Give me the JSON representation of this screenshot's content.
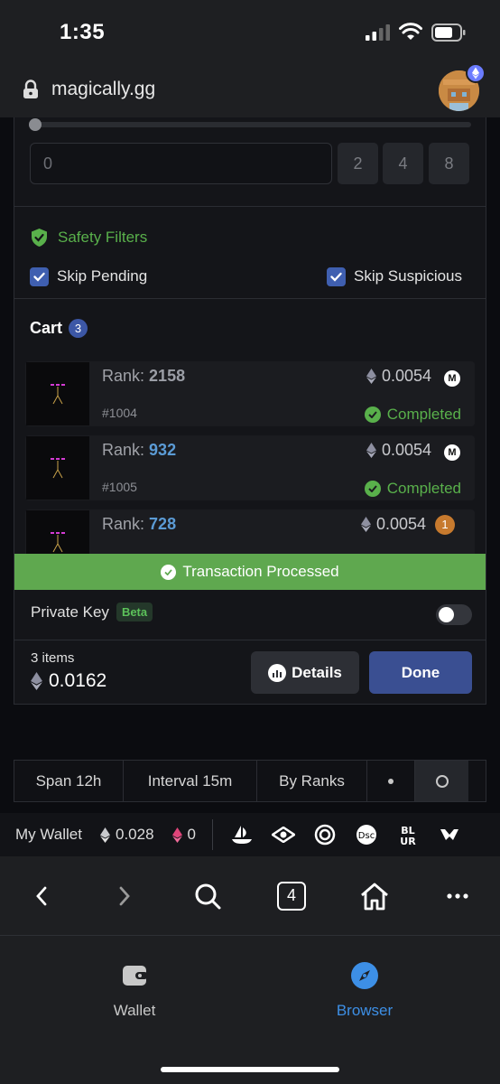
{
  "status_bar": {
    "time": "1:35"
  },
  "url_bar": {
    "domain": "magically.gg"
  },
  "quantity": {
    "input_value": "0",
    "presets": [
      "2",
      "4",
      "8"
    ],
    "slider_value": 0
  },
  "safety": {
    "title": "Safety Filters",
    "skip_pending": {
      "label": "Skip Pending",
      "checked": true
    },
    "skip_suspicious": {
      "label": "Skip Suspicious",
      "checked": true
    }
  },
  "cart": {
    "title": "Cart",
    "count": "3",
    "items": [
      {
        "rank_label": "Rank:",
        "rank": "2158",
        "rank_color": "#9b9ea6",
        "token": "#1004",
        "price": "0.0054",
        "status": "Completed",
        "marketplace": "M"
      },
      {
        "rank_label": "Rank:",
        "rank": "932",
        "rank_color": "#5b9bd5",
        "token": "#1005",
        "price": "0.0054",
        "status": "Completed",
        "marketplace": "M"
      },
      {
        "rank_label": "Rank:",
        "rank": "728",
        "rank_color": "#5b9bd5",
        "price": "0.0054",
        "pending_badge": "1"
      }
    ]
  },
  "transaction": {
    "message": "Transaction Processed"
  },
  "private_key": {
    "label": "Private Key",
    "badge": "Beta",
    "enabled": false
  },
  "summary": {
    "items_label": "3 items",
    "total": "0.0162",
    "details_label": "Details",
    "done_label": "Done"
  },
  "filter_bar": {
    "segments": [
      "Span 12h",
      "Interval 15m",
      "By Ranks"
    ]
  },
  "wallet_strip": {
    "label": "My Wallet",
    "eth_balance": "0.028",
    "other_balance": "0"
  },
  "browser_toolbar": {
    "tab_count": "4"
  },
  "app_tabs": {
    "wallet_label": "Wallet",
    "browser_label": "Browser",
    "active": "Browser"
  },
  "colors": {
    "accent_green": "#59b04b",
    "accent_blue": "#3a4f92",
    "browser_tab_active": "#3d8fe6"
  }
}
